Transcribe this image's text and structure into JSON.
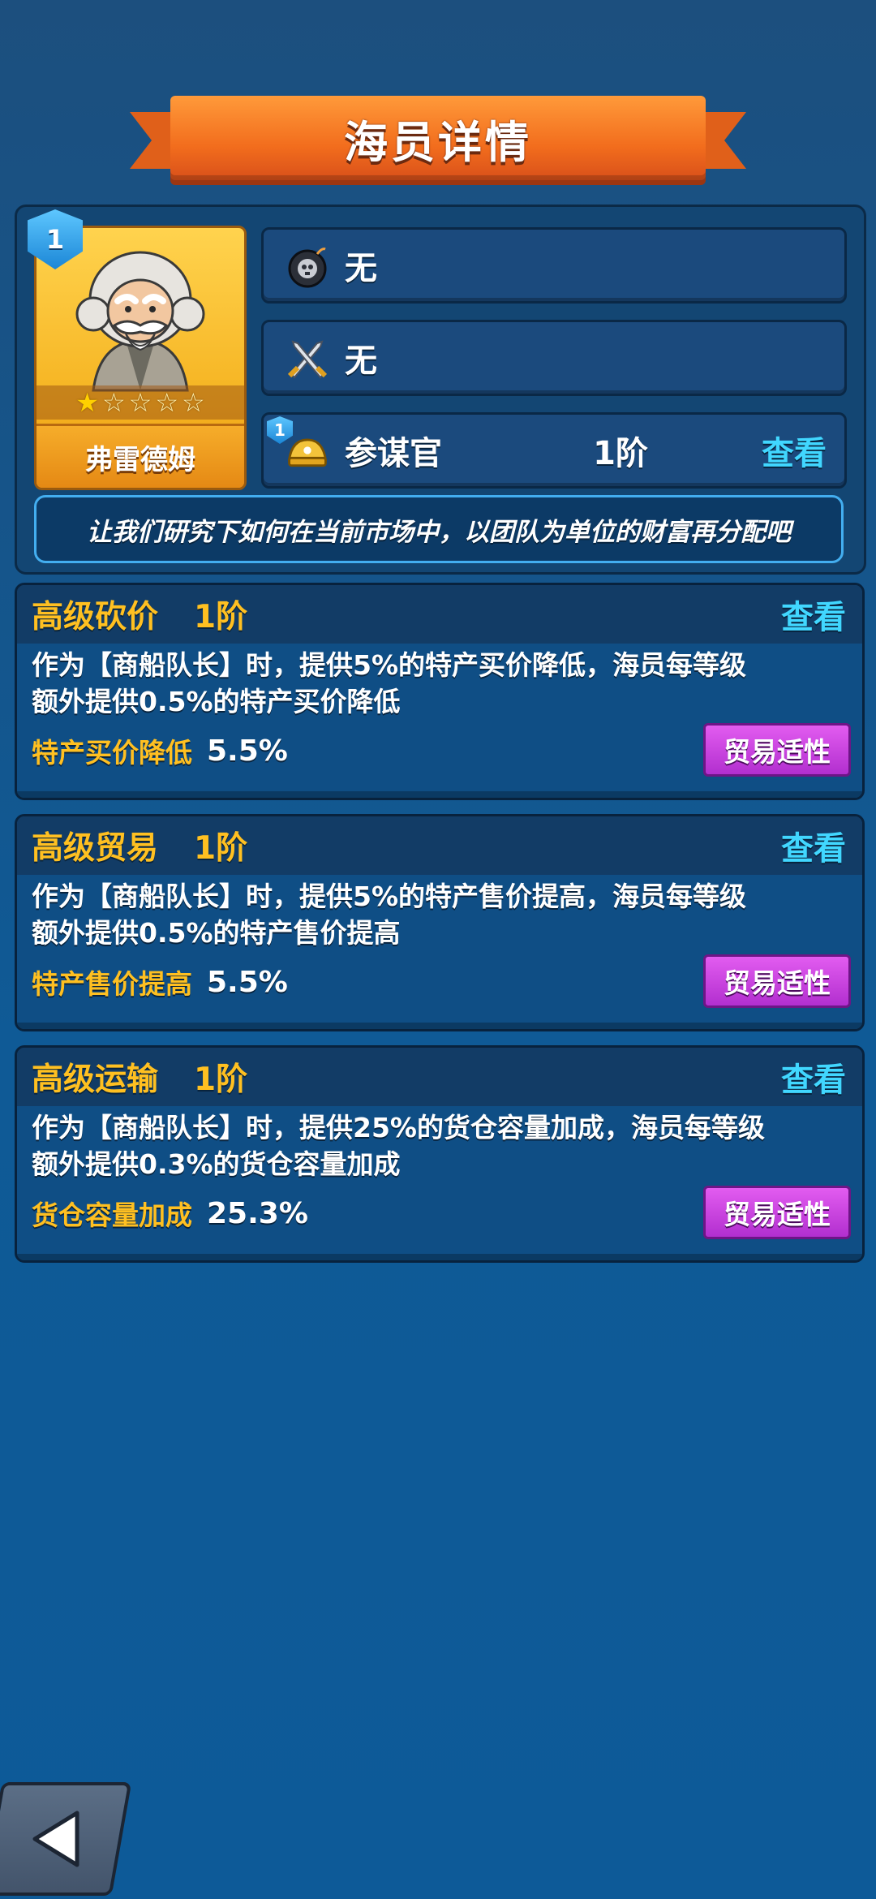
{
  "header": {
    "title": "海员详情"
  },
  "crew": {
    "level": "1",
    "name": "弗雷德姆",
    "stars_filled": 1,
    "stars_total": 5
  },
  "slots": [
    {
      "icon": "bomb-skull-icon",
      "value": "无"
    },
    {
      "icon": "crossed-swords-icon",
      "value": "无"
    }
  ],
  "role": {
    "badge_level": "1",
    "icon": "officer-hat-icon",
    "name": "参谋官",
    "tier": "1阶",
    "view_label": "查看"
  },
  "quote": "让我们研究下如何在当前市场中，以团队为单位的财富再分配吧",
  "skills": [
    {
      "name": "高级砍价",
      "tier": "1阶",
      "view_label": "查看",
      "description_line1": "作为【商船队长】时，提供5%的特产买价降低，海员每等级",
      "description_line2": "额外提供0.5%的特产买价降低",
      "stat_label": "特产买价降低",
      "stat_value": "5.5%",
      "button_label": "贸易适性"
    },
    {
      "name": "高级贸易",
      "tier": "1阶",
      "view_label": "查看",
      "description_line1": "作为【商船队长】时，提供5%的特产售价提高，海员每等级",
      "description_line2": "额外提供0.5%的特产售价提高",
      "stat_label": "特产售价提高",
      "stat_value": "5.5%",
      "button_label": "贸易适性"
    },
    {
      "name": "高级运输",
      "tier": "1阶",
      "view_label": "查看",
      "description_line1": "作为【商船队长】时，提供25%的货仓容量加成，海员每等级",
      "description_line2": "额外提供0.3%的货仓容量加成",
      "stat_label": "货仓容量加成",
      "stat_value": "25.3%",
      "button_label": "贸易适性"
    }
  ],
  "footer": {
    "back_icon": "back-arrow-icon"
  },
  "colors": {
    "accent_gold": "#ffc021",
    "link_cyan": "#41d7ff",
    "button_purple": "#c03fd9",
    "banner_orange": "#f26d1d"
  }
}
